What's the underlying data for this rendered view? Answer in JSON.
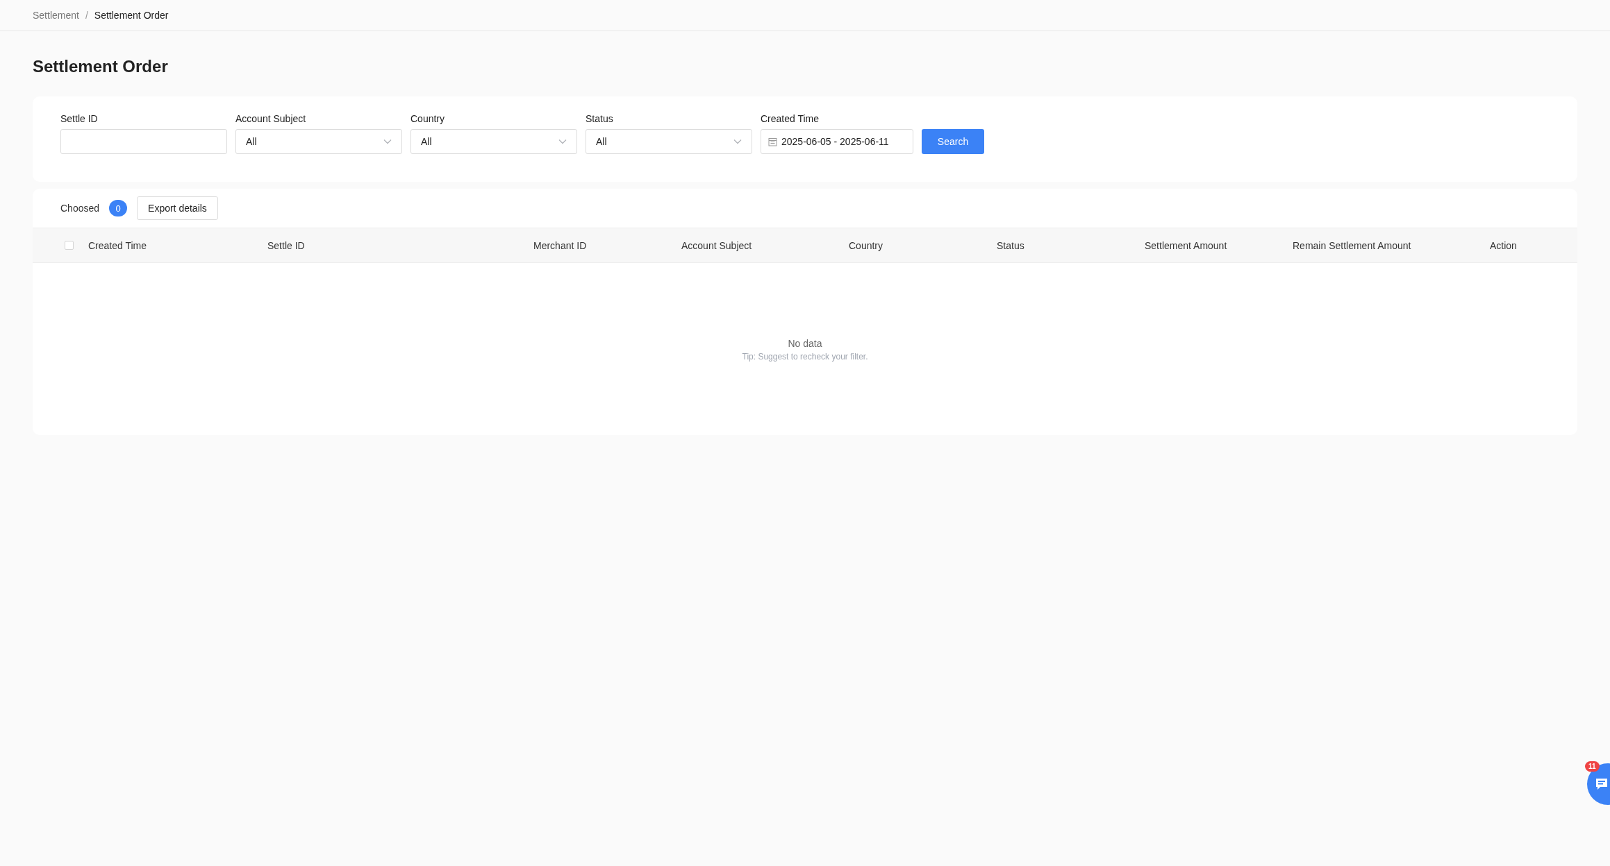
{
  "breadcrumb_separator": "/",
  "breadcrumb": [
    {
      "label": "Settlement",
      "current": false
    },
    {
      "label": "Settlement Order",
      "current": true
    }
  ],
  "title": "Settlement Order",
  "filters": [
    {
      "kind": "text",
      "label": "Settle ID"
    },
    {
      "kind": "select",
      "label": "Account Subject",
      "value": "All"
    },
    {
      "kind": "select",
      "label": "Country",
      "value": "All"
    },
    {
      "kind": "select",
      "label": "Status",
      "value": "All"
    },
    {
      "kind": "date",
      "label": "Created Time",
      "value": "2025-06-05 - 2025-06-11"
    }
  ],
  "search_button": "Search",
  "toolbar": {
    "chosen_label": "Choosed",
    "chosen_count": "0",
    "export_button": "Export details"
  },
  "table": {
    "select_all_checked": false,
    "columns": [
      "Created Time",
      "Settle ID",
      "Merchant ID",
      "Account Subject",
      "Country",
      "Status",
      "Settlement Amount",
      "Remain Settlement Amount",
      "Action"
    ],
    "empty": {
      "message": "No data",
      "tip": "Tip: Suggest to recheck your filter."
    }
  },
  "chat": {
    "badge": "11"
  }
}
